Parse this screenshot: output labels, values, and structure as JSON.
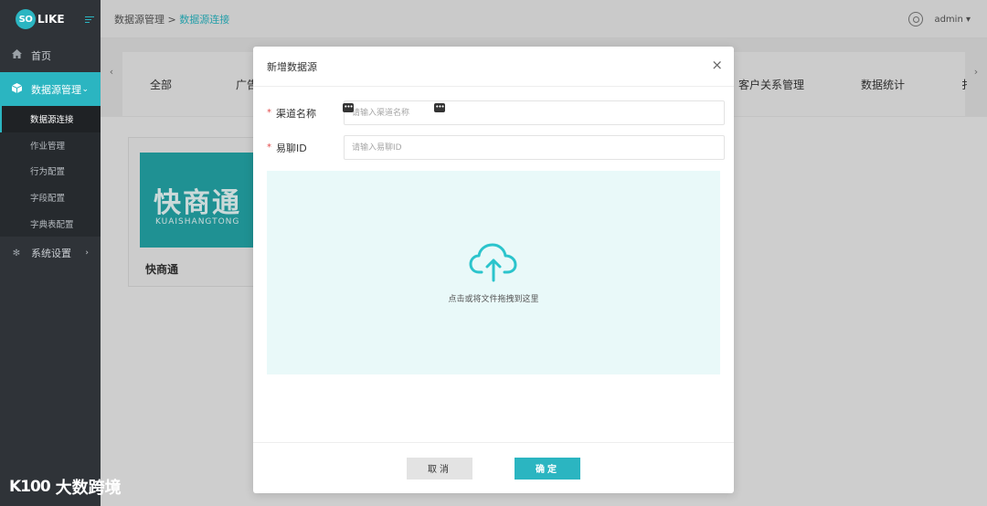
{
  "app": {
    "logo_badge": "SO",
    "logo_text": "LIKE"
  },
  "sidebar": {
    "items": [
      {
        "icon": "home-icon",
        "label": "首页"
      },
      {
        "icon": "cube-icon",
        "label": "数据源管理",
        "expanded": true
      },
      {
        "icon": "gear-icon",
        "label": "系统设置"
      }
    ],
    "subitems": [
      "数据源连接",
      "作业管理",
      "行为配置",
      "字段配置",
      "字典表配置"
    ]
  },
  "header": {
    "breadcrumb_parent": "数据源管理 >",
    "breadcrumb_current": "数据源连接",
    "user": "admin"
  },
  "category_tabs": [
    "全部",
    "广告",
    "客户关系管理",
    "数据统计",
    "扌"
  ],
  "card": {
    "logo_big": "快商通",
    "logo_small": "KUAISHANGTONG",
    "title": "快商通"
  },
  "modal": {
    "title": "新增数据源",
    "close": "×",
    "fields": [
      {
        "label": "渠道名称",
        "placeholder": "请输入渠道名称"
      },
      {
        "label": "易聊ID",
        "placeholder": "请输入易聊ID"
      }
    ],
    "upload_text": "点击或将文件拖拽到这里",
    "cancel": "取消",
    "confirm": "确定"
  },
  "watermark": {
    "logo": "K100",
    "text": "大数跨境"
  },
  "colors": {
    "accent": "#2bb5c1",
    "sidebar_bg": "#2f3338",
    "upload_bg": "#e9f9f9"
  }
}
